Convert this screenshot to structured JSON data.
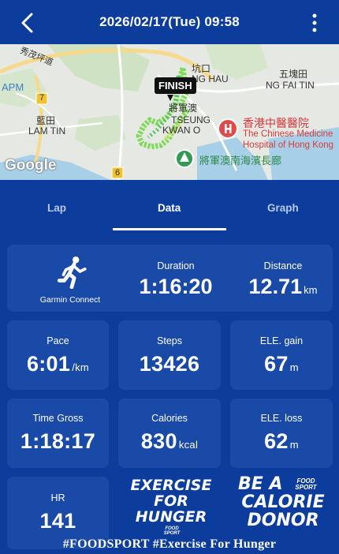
{
  "header": {
    "title": "2026/02/17(Tue) 09:58",
    "back_icon": "chevron-left-icon",
    "more_icon": "more-vertical-icon"
  },
  "map": {
    "labels": {
      "kowloon_bay_road": "秀茂坪道",
      "apm": "APM",
      "lam_tin_cn": "藍田",
      "lam_tin_en": "LAM TIN",
      "hang_hau": "坑口",
      "hang_hau_en": "NG HAU",
      "tseung_kwan_o_cn": "將軍澳",
      "tseung_kwan_o_en1": "TSEUNG",
      "tseung_kwan_o_en2": "KWAN O",
      "ng_fai_tin_cn": "五塊田",
      "ng_fai_tin_en": "NG FAI TIN",
      "route_7": "7",
      "route_6": "6"
    },
    "finish_label": "FINISH",
    "hospital_cn": "香港中醫醫院",
    "hospital_en": "The Chinese Medicine Hospital of Hong Kong",
    "park_label": "將軍澳南海濱長廊",
    "attribution": "Google"
  },
  "tabs": [
    {
      "label": "Lap",
      "active": false
    },
    {
      "label": "Data",
      "active": true
    },
    {
      "label": "Graph",
      "active": false
    }
  ],
  "source": {
    "label": "Garmin Connect",
    "icon": "running-person-icon"
  },
  "stats": {
    "duration": {
      "label": "Duration",
      "value": "1:16:20"
    },
    "distance": {
      "label": "Distance",
      "value": "12.71",
      "unit": "km"
    },
    "pace": {
      "label": "Pace",
      "value": "6:01",
      "unit": "/km"
    },
    "steps": {
      "label": "Steps",
      "value": "13426"
    },
    "ele_gain": {
      "label": "ELE. gain",
      "value": "67",
      "unit": "m"
    },
    "time_gross": {
      "label": "Time Gross",
      "value": "1:18:17"
    },
    "calories": {
      "label": "Calories",
      "value": "830",
      "unit": "kcal"
    },
    "ele_loss": {
      "label": "ELE. loss",
      "value": "62",
      "unit": "m"
    },
    "hr": {
      "label": "HR",
      "value": "141"
    }
  },
  "promo": {
    "exercise_line1": "EXERCISE",
    "exercise_line2": "FOR",
    "exercise_line3": "HUNGER",
    "exercise_logo": "FOOD SPORT",
    "donor_line1": "BE A",
    "donor_line2": "CALORIE",
    "donor_line3": "DONOR",
    "donor_logo": "FOOD SPORT"
  },
  "footer": {
    "hashtags": "#FOODSPORT #Exercise For Hunger"
  },
  "colors": {
    "background": "#0c3d9c",
    "card": "#1a4aa8",
    "hospital": "#d83a3a",
    "route": "#7ed957"
  }
}
